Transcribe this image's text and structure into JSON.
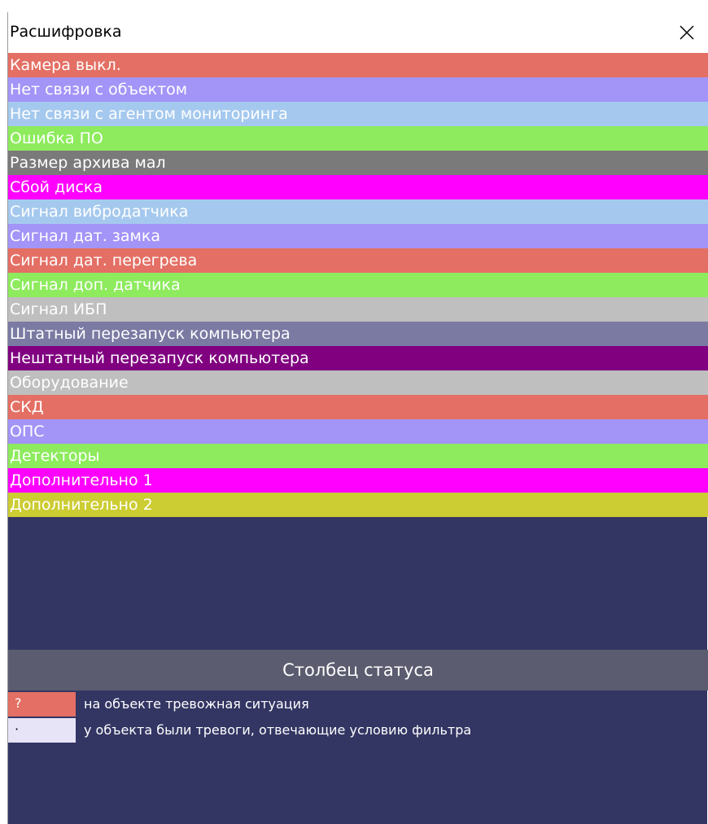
{
  "window": {
    "title": "Расшифровка",
    "close_icon": "close-icon"
  },
  "legend": [
    {
      "label": "Камера выкл.",
      "color": "#e46f64"
    },
    {
      "label": "Нет связи с объектом",
      "color": "#a394f8"
    },
    {
      "label": "Нет связи с агентом мониторинга",
      "color": "#a5c9ee"
    },
    {
      "label": "Ошибка ПО",
      "color": "#8deb5d"
    },
    {
      "label": "Размер архива мал",
      "color": "#7a7a7a"
    },
    {
      "label": "Сбой диска",
      "color": "#ff00ff"
    },
    {
      "label": "Сигнал вибродатчика",
      "color": "#a5c9ee"
    },
    {
      "label": "Сигнал дат. замка",
      "color": "#a394f8"
    },
    {
      "label": "Сигнал дат. перегрева",
      "color": "#e46f64"
    },
    {
      "label": "Сигнал доп. датчика",
      "color": "#8deb5d"
    },
    {
      "label": "Сигнал ИБП",
      "color": "#bfbfbf"
    },
    {
      "label": "Штатный перезапуск компьютера",
      "color": "#7a7aa3"
    },
    {
      "label": "Нештатный перезапуск компьютера",
      "color": "#800080"
    },
    {
      "label": "Оборудование",
      "color": "#bfbfbf"
    },
    {
      "label": "СКД",
      "color": "#e46f64"
    },
    {
      "label": "ОПС",
      "color": "#a394f8"
    },
    {
      "label": "Детекторы",
      "color": "#8deb5d"
    },
    {
      "label": "Дополнительно 1",
      "color": "#ff00ff"
    },
    {
      "label": "Дополнительно 2",
      "color": "#cccc33"
    }
  ],
  "status_section": {
    "header": "Столбец статуса",
    "rows": [
      {
        "symbol": "?",
        "description": "на объекте тревожная ситуация",
        "color": "#e46f64"
      },
      {
        "symbol": "·",
        "description": "у объекта были тревоги, отвечающие условию фильтра",
        "color": "#e8e4f8"
      }
    ]
  },
  "colors": {
    "panel_background": "#333663",
    "status_header_background": "#5c5c70",
    "titlebar_background": "#ffffff"
  }
}
